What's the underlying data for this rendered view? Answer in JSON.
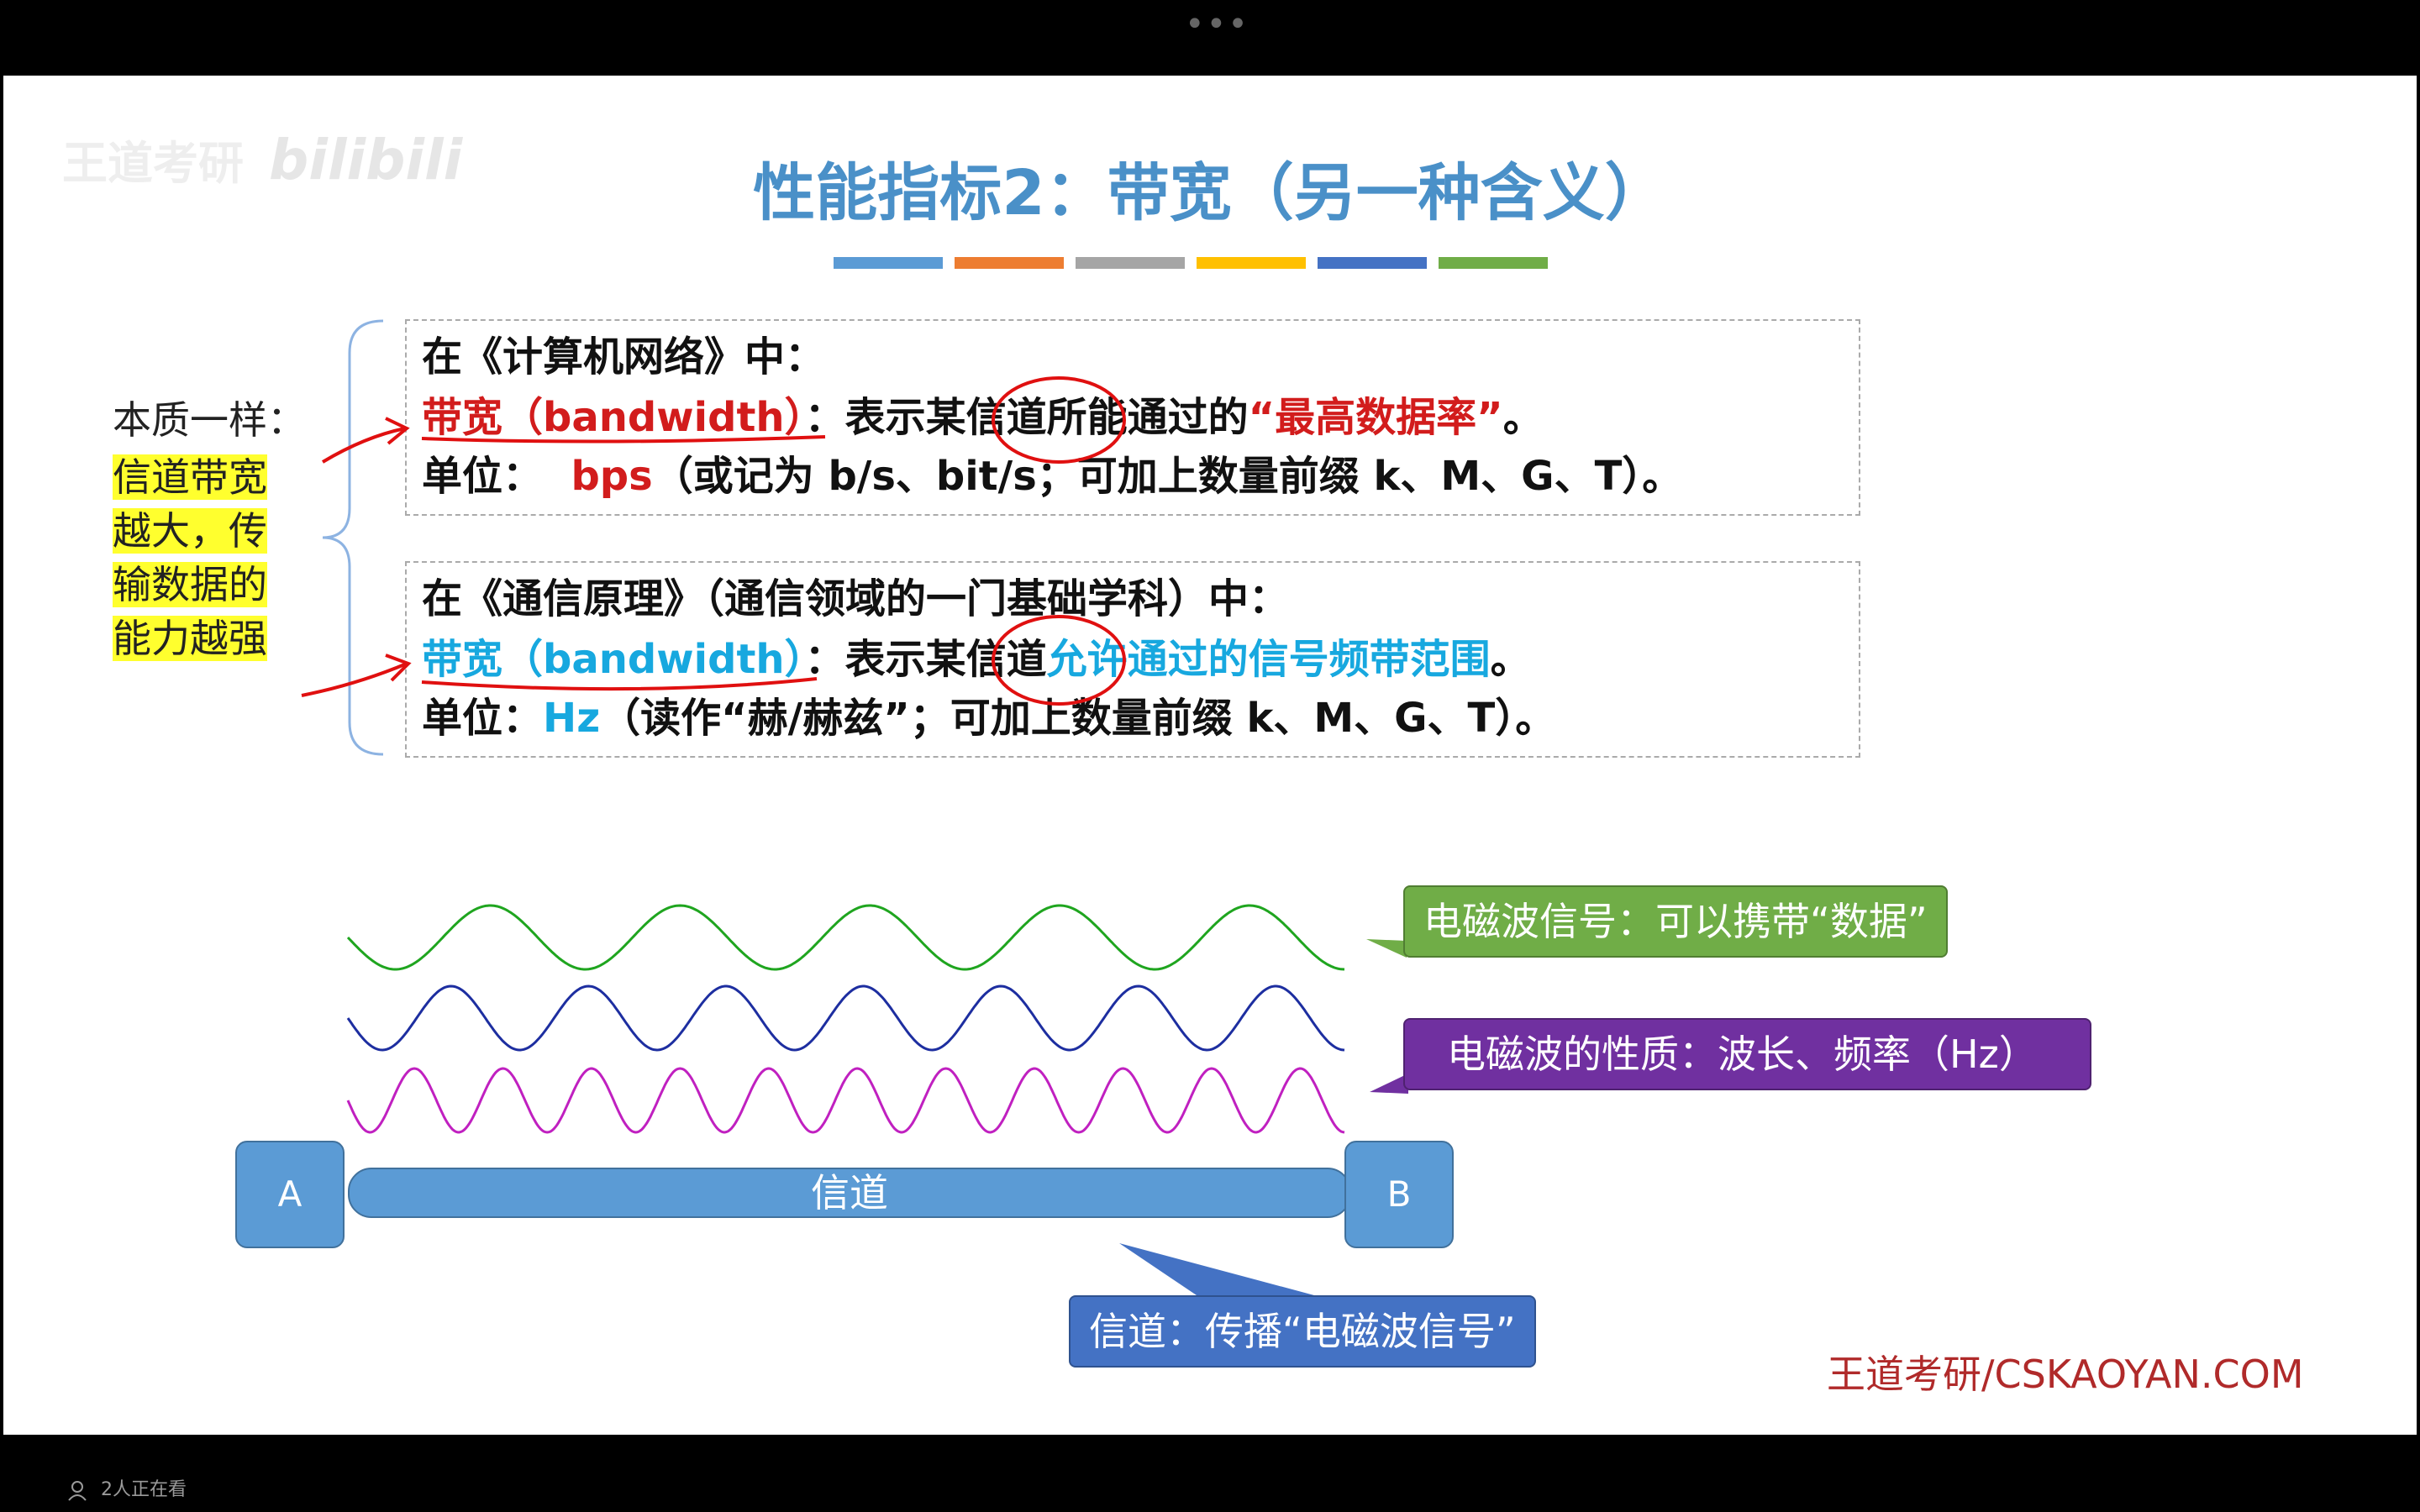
{
  "top": {
    "dots": "•••"
  },
  "bottom": {
    "viewers": "2人正在看"
  },
  "watermark": {
    "left": "王道考研",
    "right": "bilibili"
  },
  "slide": {
    "title": "性能指标2：带宽（另一种含义）",
    "title_bar_colors": [
      "#5b9bd5",
      "#ed7d31",
      "#a5a5a5",
      "#ffc000",
      "#4472c4",
      "#70ad47"
    ],
    "left_label": "本质一样：",
    "left_highlight": [
      "信道带宽",
      "越大，传",
      "输数据的",
      "能力越强"
    ],
    "box1": {
      "line1": "在《计算机网络》中：",
      "line2_term": "带宽（bandwidth）",
      "line2_mid": "：表示某信道所能通过的",
      "line2_emph": "“最高数据率”",
      "line2_end": "。",
      "line3_pre": "单位：",
      "line3_unit": "bps",
      "line3_rest": "（或记为 b/s、bit/s；可加上数量前缀 k、M、G、T）。"
    },
    "box2": {
      "line1": "在《通信原理》（通信领域的一门基础学科）中：",
      "line2_term": "带宽（bandwidth）",
      "line2_mid": "：表示某信道",
      "line2_emph": "允许通过的信号频带范围",
      "line2_end": "。",
      "line3_pre": "单位：",
      "line3_unit": "Hz",
      "line3_rest": "（读作“赫/赫兹”；可加上数量前缀 k、M、G、T）。"
    },
    "callout_green": "电磁波信号：可以携带“数据”",
    "callout_purple": "电磁波的性质：波长、频率（Hz）",
    "callout_blue": "信道：传播“电磁波信号”",
    "node_a": "A",
    "node_b": "B",
    "pipe_label": "信道",
    "brand": "王道考研/CSKAOYAN.COM",
    "colors": {
      "title": "#4a90c8",
      "red": "#d21c1c",
      "cyan": "#17a8df",
      "highlight": "#ffff2e",
      "green_wave": "#1fa51f",
      "blue_wave": "#1d2ea0",
      "magenta_wave": "#c020c0",
      "callout_green": "#70ad47",
      "callout_purple": "#7030a0",
      "callout_blue": "#4472c4"
    }
  }
}
